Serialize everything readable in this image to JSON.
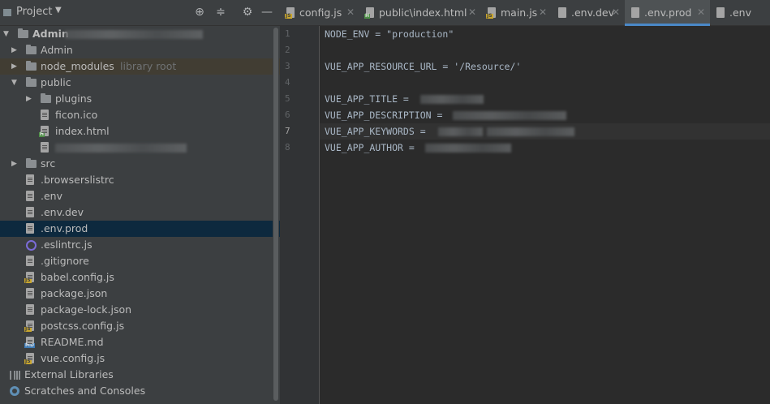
{
  "project_panel": {
    "title": "Project",
    "tools": [
      "locate-icon",
      "collapse-icon",
      "gear-icon",
      "hide-icon"
    ],
    "tree": [
      {
        "label": "Admin",
        "kind": "folder",
        "depth": 0,
        "expanded": true,
        "bold": true
      },
      {
        "label": "Admin",
        "kind": "folder",
        "depth": 1,
        "expanded": false
      },
      {
        "label": "node_modules",
        "suffix": "library root",
        "kind": "folder",
        "depth": 1,
        "expanded": false
      },
      {
        "label": "public",
        "kind": "folder",
        "depth": 1,
        "expanded": true
      },
      {
        "label": "plugins",
        "kind": "folder",
        "depth": 2,
        "expanded": false
      },
      {
        "label": "ficon.ico",
        "kind": "file",
        "depth": 2
      },
      {
        "label": "index.html",
        "kind": "file-html",
        "depth": 2
      },
      {
        "label": "",
        "kind": "file-blurred",
        "depth": 2
      },
      {
        "label": "src",
        "kind": "folder",
        "depth": 1,
        "expanded": false
      },
      {
        "label": ".browserslistrc",
        "kind": "file",
        "depth": 1
      },
      {
        "label": ".env",
        "kind": "file",
        "depth": 1
      },
      {
        "label": ".env.dev",
        "kind": "file",
        "depth": 1
      },
      {
        "label": ".env.prod",
        "kind": "file",
        "depth": 1,
        "selected": true
      },
      {
        "label": ".eslintrc.js",
        "kind": "file-eslint",
        "depth": 1
      },
      {
        "label": ".gitignore",
        "kind": "file",
        "depth": 1
      },
      {
        "label": "babel.config.js",
        "kind": "file-js",
        "depth": 1
      },
      {
        "label": "package.json",
        "kind": "file",
        "depth": 1
      },
      {
        "label": "package-lock.json",
        "kind": "file",
        "depth": 1
      },
      {
        "label": "postcss.config.js",
        "kind": "file-js",
        "depth": 1
      },
      {
        "label": "README.md",
        "kind": "file-md",
        "depth": 1
      },
      {
        "label": "vue.config.js",
        "kind": "file-js",
        "depth": 1
      },
      {
        "label": "External Libraries",
        "kind": "libs",
        "depth": 0
      },
      {
        "label": "Scratches and Consoles",
        "kind": "scratch",
        "depth": 0
      }
    ]
  },
  "tabs": [
    {
      "label": "config.js",
      "icon": "js",
      "active": false
    },
    {
      "label": "public\\index.html",
      "icon": "html",
      "active": false
    },
    {
      "label": "main.js",
      "icon": "js",
      "active": false
    },
    {
      "label": ".env.dev",
      "icon": "file",
      "active": false
    },
    {
      "label": ".env.prod",
      "icon": "file",
      "active": true
    },
    {
      "label": ".env",
      "icon": "file",
      "active": false
    }
  ],
  "editor": {
    "current_line": 7,
    "lines": [
      {
        "n": "1",
        "text": "NODE_ENV = \"production\""
      },
      {
        "n": "2",
        "text": ""
      },
      {
        "n": "3",
        "text": "VUE_APP_RESOURCE_URL = '/Resource/'"
      },
      {
        "n": "4",
        "text": ""
      },
      {
        "n": "5",
        "text": "VUE_APP_TITLE = "
      },
      {
        "n": "6",
        "text": "VUE_APP_DESCRIPTION = "
      },
      {
        "n": "7",
        "text": "VUE_APP_KEYWORDS = "
      },
      {
        "n": "8",
        "text": "VUE_APP_AUTHOR = "
      }
    ]
  },
  "colors": {
    "panel_bg": "#3c3f41",
    "editor_bg": "#2b2b2b",
    "selection": "#0d293e",
    "library_highlight": "#413d33",
    "active_tab_underline": "#4a88c7",
    "code_text": "#a9b7c6"
  }
}
